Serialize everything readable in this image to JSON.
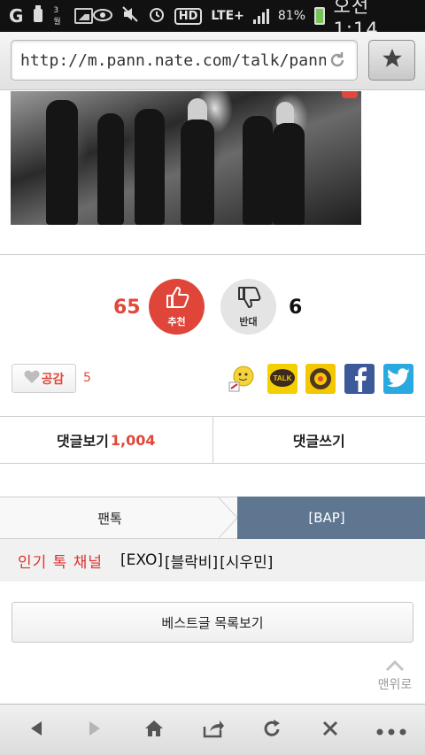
{
  "status_bar": {
    "carrier_logo": "G",
    "mini_text": "3월",
    "battery": "81%",
    "time": "오전 1:14",
    "hd": "HD",
    "lte": "LTE+"
  },
  "browser": {
    "url": "http://m.pann.nate.com/talk/pann/1",
    "icons": [
      "refresh-icon",
      "star-icon"
    ]
  },
  "votes": {
    "up_count": "65",
    "up_label": "추천",
    "down_label": "반대",
    "down_count": "6"
  },
  "share": {
    "like_label": "공감",
    "like_count": "5",
    "talk_label": "TALK"
  },
  "comments": {
    "view_label": "댓글보기",
    "count": "1,004",
    "write_label": "댓글쓰기"
  },
  "tabs": {
    "left": "팬톡",
    "right": "[BAP]"
  },
  "channel": {
    "title": "인기 톡 채널",
    "items": [
      "[EXO]",
      "[블락비]",
      "[시우민]"
    ]
  },
  "best_list_label": "베스트글 목록보기",
  "top_label": "맨위로",
  "colors": {
    "accent_red": "#e0453a",
    "tab_blue": "#5f7690"
  }
}
